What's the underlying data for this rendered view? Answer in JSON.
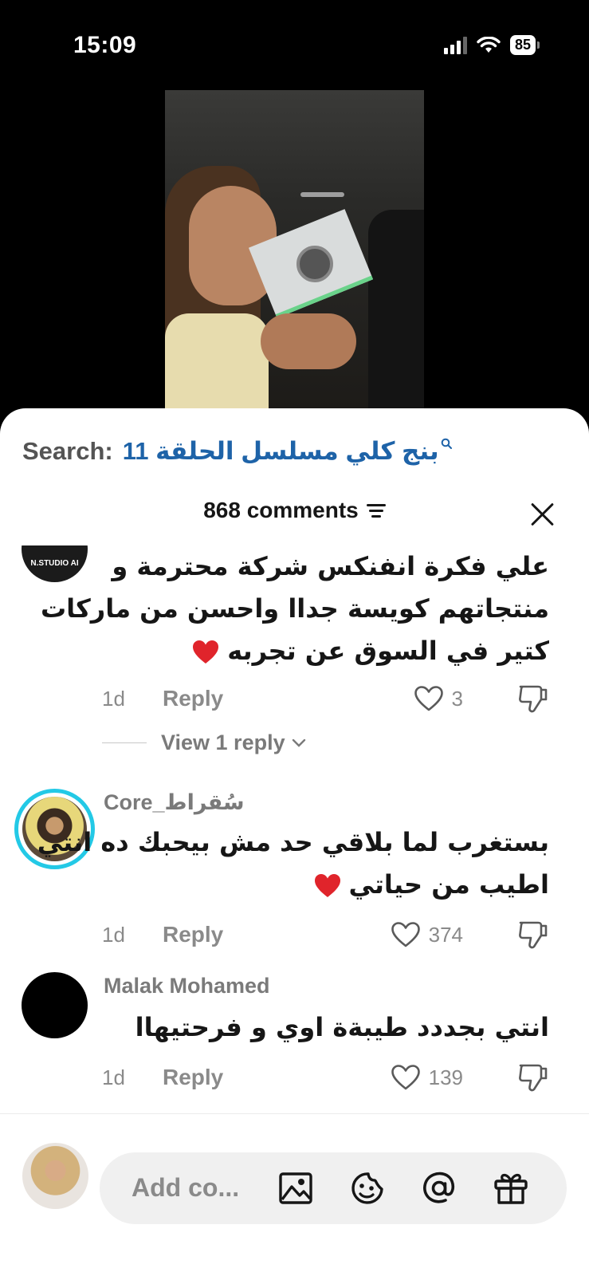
{
  "status_bar": {
    "time": "15:09",
    "battery": "85"
  },
  "search": {
    "prefix": "Search:",
    "query": "بنج كلي مسلسل الحلقة 11"
  },
  "header": {
    "comments_count": "868 comments"
  },
  "comments": [
    {
      "avatar_label": "N.STUDIO AI",
      "text_lines": [
        "علي فكرة انفنكس شركة محترمة و",
        "منتجاتهم كويسة جداا واحسن من ماركات",
        "كتير في السوق عن تجربه"
      ],
      "time": "1d",
      "reply_label": "Reply",
      "likes": "3",
      "view_replies": "View 1 reply"
    },
    {
      "author": "Core_سُقراط",
      "text_lines": [
        "بستغرب لما بلاقي حد مش بيحبك ده انتي",
        "اطيب من حياتي"
      ],
      "time": "1d",
      "reply_label": "Reply",
      "likes": "374"
    },
    {
      "author": "Malak Mohamed",
      "text_lines": [
        "انتي بجددد طيبةة اوي و فرحتيهاا"
      ],
      "time": "1d",
      "reply_label": "Reply",
      "likes": "139"
    }
  ],
  "input": {
    "placeholder": "Add co..."
  },
  "icons": {
    "search": "search-icon",
    "filter": "filter-icon",
    "close": "close-icon",
    "like": "heart-outline-icon",
    "dislike": "thumbs-down-icon",
    "image": "image-icon",
    "emoji": "emoji-icon",
    "mention": "at-icon",
    "gift": "gift-icon"
  },
  "colors": {
    "search_query": "#1e63a8",
    "story_ring": "#23c9e6",
    "heart_emoji": "#e0242b"
  }
}
